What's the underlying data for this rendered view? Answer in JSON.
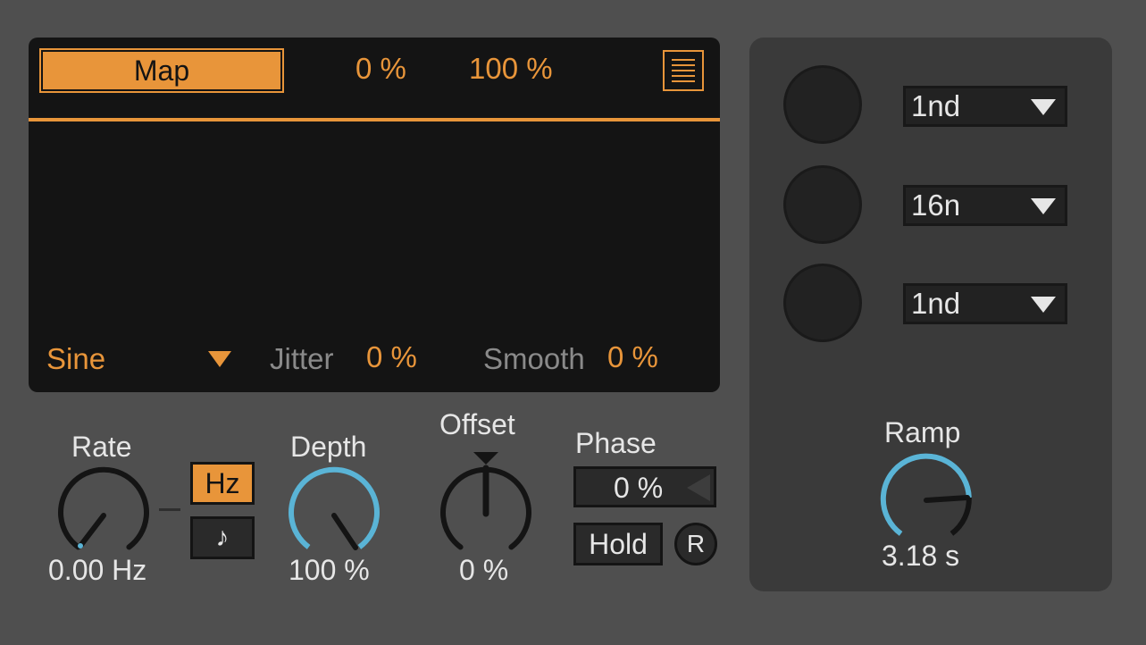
{
  "display": {
    "map_label": "Map",
    "min_value": "0 %",
    "max_value": "100 %",
    "menu_icon": "list-menu-icon",
    "shape_value": "Sine",
    "jitter_label": "Jitter",
    "jitter_value": "0 %",
    "smooth_label": "Smooth",
    "smooth_value": "0 %"
  },
  "rate": {
    "label": "Rate",
    "value": "0.00 Hz",
    "hz_label": "Hz",
    "note_icon": "♪"
  },
  "depth": {
    "label": "Depth",
    "value": "100 %",
    "level": 1.0
  },
  "offset": {
    "label": "Offset",
    "value": "0 %"
  },
  "phase": {
    "label": "Phase",
    "value": "0 %",
    "hold_label": "Hold",
    "retrigger_label": "R"
  },
  "side": {
    "dropdowns": [
      {
        "value": "1nd"
      },
      {
        "value": "16n"
      },
      {
        "value": "1nd"
      }
    ],
    "ramp_label": "Ramp",
    "ramp_value": "3.18 s"
  },
  "colors": {
    "accent": "#e8953a",
    "knob_arc": "#5ab4d6",
    "panel": "#141414"
  }
}
